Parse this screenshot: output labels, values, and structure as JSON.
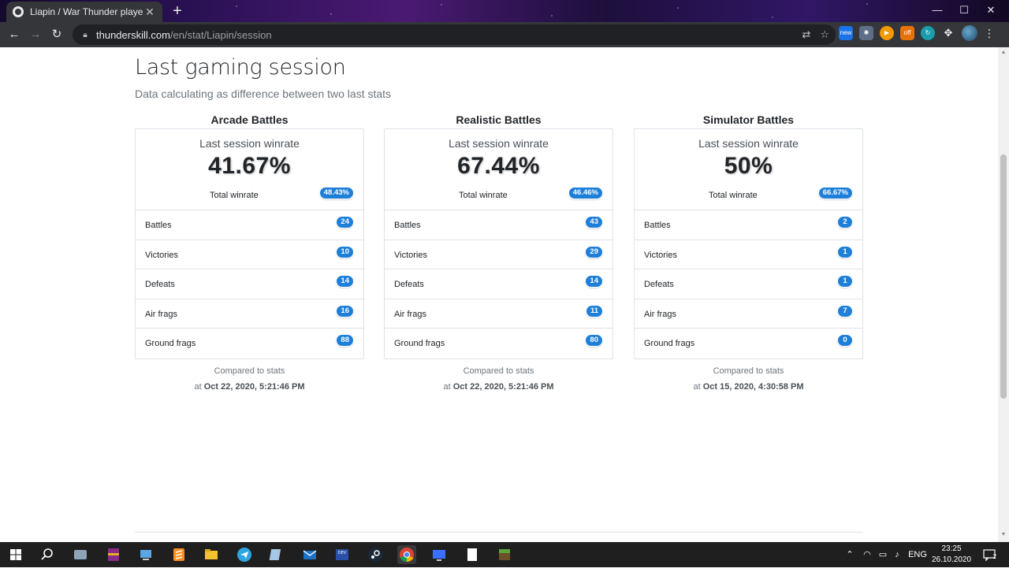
{
  "browser": {
    "tab_title": "Liapin / War Thunder player stati",
    "url_host": "thunderskill.com",
    "url_path": "/en/stat/Liapin/session",
    "new_tab": "+",
    "minimize": "—",
    "maximize": "☐",
    "close": "✕"
  },
  "page": {
    "title": "Last gaming session",
    "subtitle": "Data calculating as difference between two last stats"
  },
  "modes": [
    {
      "name": "Arcade Battles",
      "session_label": "Last session winrate",
      "session_winrate": "41.67%",
      "total_label": "Total winrate",
      "total_winrate": "48.43%",
      "rows": [
        {
          "label": "Battles",
          "value": "24"
        },
        {
          "label": "Victories",
          "value": "10"
        },
        {
          "label": "Defeats",
          "value": "14"
        },
        {
          "label": "Air frags",
          "value": "16"
        },
        {
          "label": "Ground frags",
          "value": "88"
        }
      ],
      "compared_label": "Compared to stats",
      "compared_prefix": "at",
      "compared_date": "Oct 22, 2020, 5:21:46 PM"
    },
    {
      "name": "Realistic Battles",
      "session_label": "Last session winrate",
      "session_winrate": "67.44%",
      "total_label": "Total winrate",
      "total_winrate": "46.46%",
      "rows": [
        {
          "label": "Battles",
          "value": "43"
        },
        {
          "label": "Victories",
          "value": "29"
        },
        {
          "label": "Defeats",
          "value": "14"
        },
        {
          "label": "Air frags",
          "value": "11"
        },
        {
          "label": "Ground frags",
          "value": "80"
        }
      ],
      "compared_label": "Compared to stats",
      "compared_prefix": "at",
      "compared_date": "Oct 22, 2020, 5:21:46 PM"
    },
    {
      "name": "Simulator Battles",
      "session_label": "Last session winrate",
      "session_winrate": "50%",
      "total_label": "Total winrate",
      "total_winrate": "66.67%",
      "rows": [
        {
          "label": "Battles",
          "value": "2"
        },
        {
          "label": "Victories",
          "value": "1"
        },
        {
          "label": "Defeats",
          "value": "1"
        },
        {
          "label": "Air frags",
          "value": "7"
        },
        {
          "label": "Ground frags",
          "value": "0"
        }
      ],
      "compared_label": "Compared to stats",
      "compared_prefix": "at",
      "compared_date": "Oct 15, 2020, 4:30:58 PM"
    }
  ],
  "taskbar": {
    "language": "ENG",
    "time": "23:25",
    "date": "26.10.2020",
    "notification_count": "2"
  },
  "colors": {
    "badge": "#1e7fd9",
    "chrome_dark": "#35363a",
    "taskbar": "#1f1f1f"
  }
}
